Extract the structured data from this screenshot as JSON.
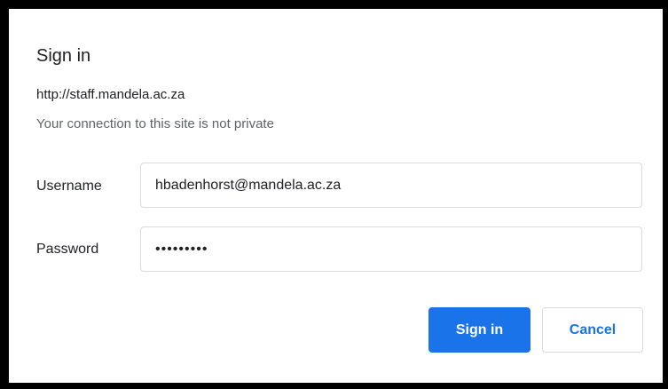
{
  "dialog": {
    "title": "Sign in",
    "origin": "http://staff.mandela.ac.za",
    "warning": "Your connection to this site is not private"
  },
  "form": {
    "username_label": "Username",
    "username_value": "hbadenhorst@mandela.ac.za",
    "password_label": "Password",
    "password_value": "•••••••••"
  },
  "buttons": {
    "sign_in": "Sign in",
    "cancel": "Cancel"
  },
  "colors": {
    "primary": "#1a73e8",
    "border": "#dadce0",
    "text": "#202124",
    "muted": "#5f6368"
  }
}
